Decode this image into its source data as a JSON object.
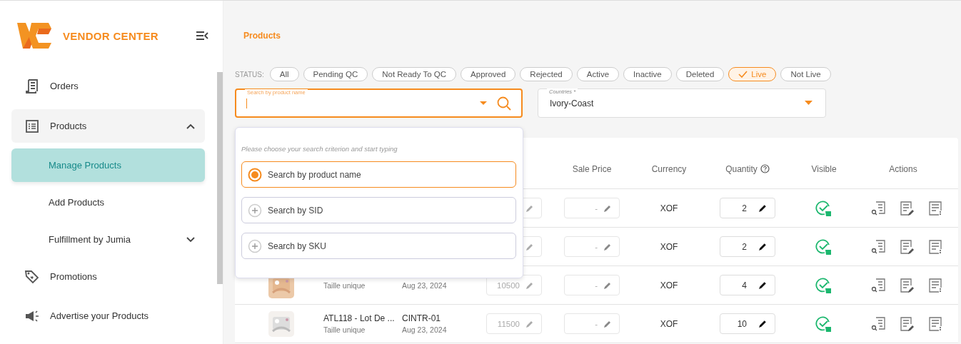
{
  "brand": "VENDOR CENTER",
  "sidebar": {
    "items": [
      {
        "label": "Orders",
        "selected": false
      },
      {
        "label": "Products",
        "selected": false,
        "expanded": true,
        "children": [
          {
            "label": "Manage Products",
            "selected": true
          },
          {
            "label": "Add Products",
            "selected": false
          },
          {
            "label": "Fulfillment by Jumia",
            "selected": false,
            "expanded": false
          }
        ]
      },
      {
        "label": "Promotions",
        "selected": false
      },
      {
        "label": "Advertise your Products",
        "selected": false
      }
    ]
  },
  "breadcrumb": "Products",
  "status": {
    "label": "STATUS:",
    "chips": [
      {
        "label": "All",
        "selected": false
      },
      {
        "label": "Pending QC",
        "selected": false
      },
      {
        "label": "Not Ready To QC",
        "selected": false
      },
      {
        "label": "Approved",
        "selected": false
      },
      {
        "label": "Rejected",
        "selected": false
      },
      {
        "label": "Active",
        "selected": false
      },
      {
        "label": "Inactive",
        "selected": false
      },
      {
        "label": "Deleted",
        "selected": false
      },
      {
        "label": "Live",
        "selected": true
      },
      {
        "label": "Not Live",
        "selected": false
      }
    ]
  },
  "search": {
    "label": "Search by product name"
  },
  "countries": {
    "label": "Countries *",
    "value": "Ivory-Coast"
  },
  "search_menu": {
    "hint": "Please choose your search criterion and start typing",
    "options": [
      {
        "label": "Search by product name",
        "selected": true
      },
      {
        "label": "Search by SID",
        "selected": false
      },
      {
        "label": "Search by SKU",
        "selected": false
      }
    ]
  },
  "table": {
    "columns": [
      "Sale Price",
      "Currency",
      "Quantity",
      "Visible",
      "Actions"
    ],
    "rows": [
      {
        "sale_price": "-",
        "currency": "XOF",
        "quantity": "2",
        "visible": true
      },
      {
        "sale_price": "-",
        "currency": "XOF",
        "quantity": "2",
        "visible": true
      },
      {
        "variant": "Taille unique",
        "date": "Aug 23, 2024",
        "price": "10500",
        "sale_price": "-",
        "currency": "XOF",
        "quantity": "4",
        "visible": true
      },
      {
        "name": "ATL118 - Lot De ...",
        "variant": "Taille unique",
        "sku": "CINTR-01",
        "date": "Aug 23, 2024",
        "price": "11500",
        "sale_price": "-",
        "currency": "XOF",
        "quantity": "10",
        "visible": true
      }
    ]
  }
}
